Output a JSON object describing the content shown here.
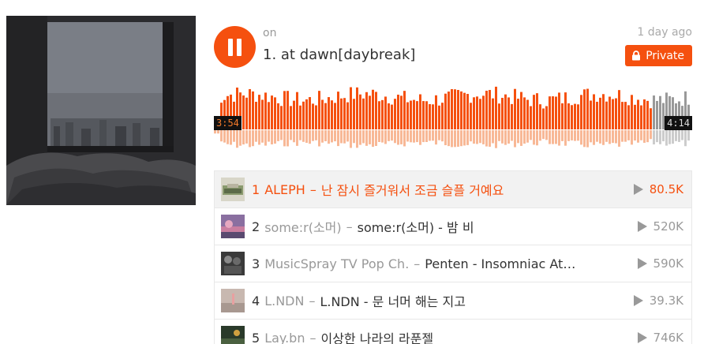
{
  "header": {
    "username": "on",
    "title": "1. at dawn[daybreak]",
    "time_ago": "1 day ago",
    "private_label": "Private"
  },
  "player": {
    "state": "playing",
    "elapsed": "3:54",
    "total": "4:14",
    "progress": 0.922
  },
  "colors": {
    "accent": "#f5500f",
    "played_wave": "#f5500f",
    "played_reflection": "#f8b896",
    "unplayed_wave": "#999999",
    "unplayed_reflection": "#cccccc"
  },
  "tracks": [
    {
      "num": "1",
      "artist": "ALEPH",
      "title": "난 잠시 즐거워서 조금 슬플 거예요",
      "plays": "80.5K",
      "active": true,
      "artist_as_title": true
    },
    {
      "num": "2",
      "artist": "some:r(소머)",
      "title": "some:r(소머) - 밤 비",
      "plays": "520K",
      "active": false
    },
    {
      "num": "3",
      "artist": "MusicSpray TV Pop Ch.",
      "title": "Penten - Insomniac At…",
      "plays": "590K",
      "active": false
    },
    {
      "num": "4",
      "artist": "L.NDN",
      "title": "L.NDN - 문 너머 해는 지고",
      "plays": "39.3K",
      "active": false
    },
    {
      "num": "5",
      "artist": "Lay.bn",
      "title": "이상한 나라의 라푼젤",
      "plays": "746K",
      "active": false
    }
  ],
  "icons": {
    "play_button": "pause-icon",
    "private": "lock-icon",
    "play_count": "play-triangle-icon"
  }
}
